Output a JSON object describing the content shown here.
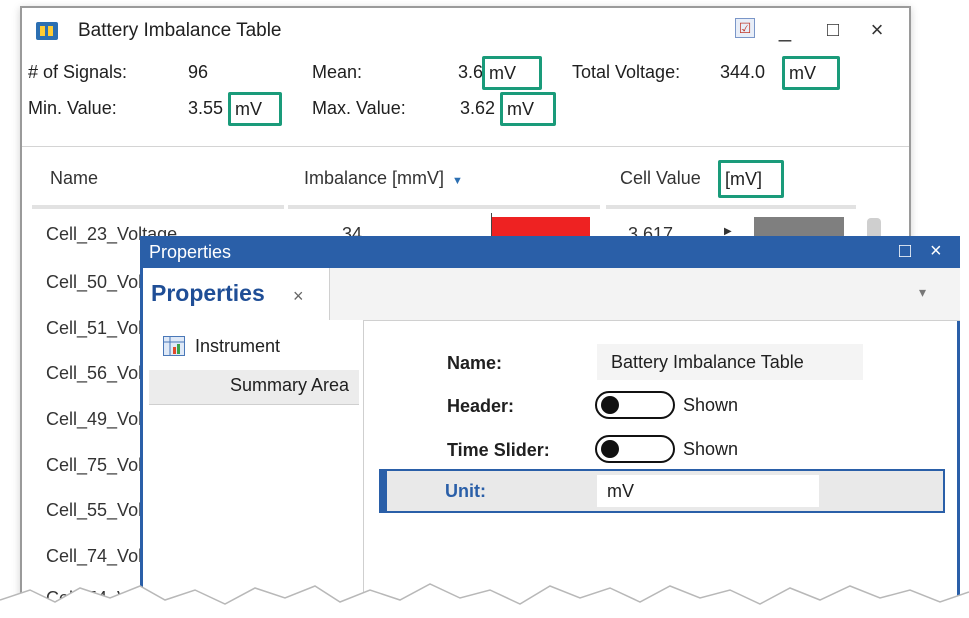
{
  "window": {
    "title": "Battery Imbalance Table",
    "check_icon": "☑",
    "minimize": "_",
    "maximize": "□",
    "close": "×"
  },
  "summary": {
    "signals_label": "# of Signals:",
    "signals_value": "96",
    "min_label": "Min. Value:",
    "min_value": "3.55",
    "min_unit": "mV",
    "mean_label": "Mean:",
    "mean_value": "3.6",
    "mean_unit": "mV",
    "max_label": "Max. Value:",
    "max_value": "3.62",
    "max_unit": "mV",
    "total_label": "Total Voltage:",
    "total_value": "344.0",
    "total_unit": "mV"
  },
  "table": {
    "col_name": "Name",
    "col_imbalance": "Imbalance [mmV]",
    "col_cell_prefix": "Cell Value",
    "col_cell_unit": "[mV]",
    "first_row": {
      "name": "Cell_23_Voltage",
      "imbalance": "34",
      "cell_value": "3.617"
    },
    "rows": [
      "Cell_50_Voltage",
      "Cell_51_Voltage",
      "Cell_56_Voltage",
      "Cell_49_Voltage",
      "Cell_75_Voltage",
      "Cell_55_Voltage",
      "Cell_74_Voltage",
      "Cell_54_Voltage"
    ]
  },
  "properties": {
    "title": "Properties",
    "tab_label": "Properties",
    "tab_close": "×",
    "overflow": "▾",
    "tree": {
      "instrument": "Instrument",
      "summary_area": "Summary Area"
    },
    "name_label": "Name:",
    "name_value": "Battery Imbalance Table",
    "header_label": "Header:",
    "header_value": "Shown",
    "slider_label": "Time Slider:",
    "slider_value": "Shown",
    "unit_label": "Unit:",
    "unit_value": "mV"
  },
  "colors": {
    "accent": "#2a5fa8",
    "highlight": "#1a9b7a",
    "imbalance_bar": "#ee2222",
    "cell_bar": "#7f7f7f"
  }
}
